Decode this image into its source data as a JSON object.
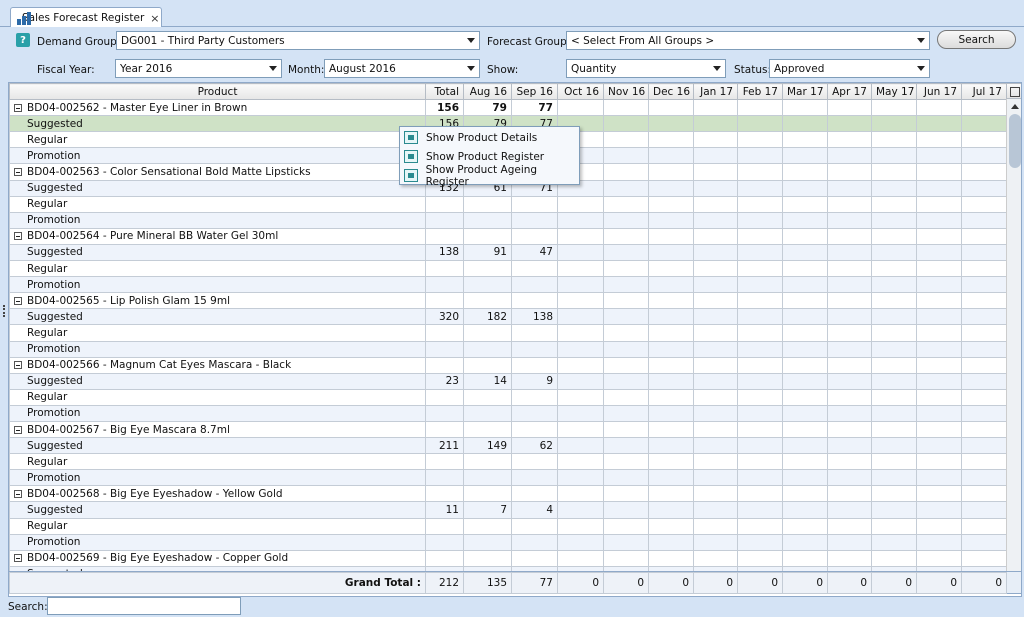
{
  "tab": {
    "title": "Sales Forecast Register",
    "close": "×"
  },
  "filters": {
    "demand_group_label": "Demand Group:",
    "demand_group_value": "DG001 - Third Party Customers",
    "forecast_group_label": "Forecast Group:",
    "forecast_group_value": "< Select From All Groups >",
    "search_button": "Search",
    "fiscal_year_label": "Fiscal Year:",
    "fiscal_year_value": "Year 2016",
    "month_label": "Month:",
    "month_value": "August 2016",
    "show_label": "Show:",
    "show_value": "Quantity",
    "status_label": "Status:",
    "status_value": "Approved"
  },
  "grid": {
    "columns": [
      "Product",
      "Total",
      "Aug 16",
      "Sep 16",
      "Oct 16",
      "Nov 16",
      "Dec 16",
      "Jan 17",
      "Feb 17",
      "Mar 17",
      "Apr 17",
      "May 17",
      "Jun 17",
      "Jul 17"
    ],
    "rows": [
      {
        "type": "parent",
        "label": "BD04-002562 - Master Eye Liner in Brown",
        "values": [
          "156",
          "79",
          "77"
        ]
      },
      {
        "type": "child",
        "label": "Suggested",
        "values": [
          "156",
          "79",
          "77"
        ],
        "highlight": true
      },
      {
        "type": "child",
        "label": "Regular",
        "values": [
          "",
          "",
          ""
        ]
      },
      {
        "type": "child",
        "label": "Promotion",
        "values": [
          "",
          "",
          ""
        ]
      },
      {
        "type": "parent",
        "label": "BD04-002563 - Color Sensational Bold Matte Lipsticks",
        "values": [
          "",
          "",
          ""
        ]
      },
      {
        "type": "child",
        "label": "Suggested",
        "values": [
          "132",
          "61",
          "71"
        ]
      },
      {
        "type": "child",
        "label": "Regular",
        "values": [
          "",
          "",
          ""
        ]
      },
      {
        "type": "child",
        "label": "Promotion",
        "values": [
          "",
          "",
          ""
        ]
      },
      {
        "type": "parent",
        "label": "BD04-002564 - Pure Mineral BB Water Gel 30ml",
        "values": [
          "",
          "",
          ""
        ]
      },
      {
        "type": "child",
        "label": "Suggested",
        "values": [
          "138",
          "91",
          "47"
        ]
      },
      {
        "type": "child",
        "label": "Regular",
        "values": [
          "",
          "",
          ""
        ]
      },
      {
        "type": "child",
        "label": "Promotion",
        "values": [
          "",
          "",
          ""
        ]
      },
      {
        "type": "parent",
        "label": "BD04-002565 - Lip Polish Glam 15 9ml",
        "values": [
          "",
          "",
          ""
        ]
      },
      {
        "type": "child",
        "label": "Suggested",
        "values": [
          "320",
          "182",
          "138"
        ]
      },
      {
        "type": "child",
        "label": "Regular",
        "values": [
          "",
          "",
          ""
        ]
      },
      {
        "type": "child",
        "label": "Promotion",
        "values": [
          "",
          "",
          ""
        ]
      },
      {
        "type": "parent",
        "label": "BD04-002566 - Magnum Cat Eyes Mascara - Black",
        "values": [
          "",
          "",
          ""
        ]
      },
      {
        "type": "child",
        "label": "Suggested",
        "values": [
          "23",
          "14",
          "9"
        ]
      },
      {
        "type": "child",
        "label": "Regular",
        "values": [
          "",
          "",
          ""
        ]
      },
      {
        "type": "child",
        "label": "Promotion",
        "values": [
          "",
          "",
          ""
        ]
      },
      {
        "type": "parent",
        "label": "BD04-002567 - Big Eye Mascara 8.7ml",
        "values": [
          "",
          "",
          ""
        ]
      },
      {
        "type": "child",
        "label": "Suggested",
        "values": [
          "211",
          "149",
          "62"
        ]
      },
      {
        "type": "child",
        "label": "Regular",
        "values": [
          "",
          "",
          ""
        ]
      },
      {
        "type": "child",
        "label": "Promotion",
        "values": [
          "",
          "",
          ""
        ]
      },
      {
        "type": "parent",
        "label": "BD04-002568 - Big Eye Eyeshadow - Yellow Gold",
        "values": [
          "",
          "",
          ""
        ]
      },
      {
        "type": "child",
        "label": "Suggested",
        "values": [
          "11",
          "7",
          "4"
        ]
      },
      {
        "type": "child",
        "label": "Regular",
        "values": [
          "",
          "",
          ""
        ]
      },
      {
        "type": "child",
        "label": "Promotion",
        "values": [
          "",
          "",
          ""
        ]
      },
      {
        "type": "parent",
        "label": "BD04-002569 - Big Eye Eyeshadow - Copper Gold",
        "values": [
          "",
          "",
          ""
        ]
      },
      {
        "type": "child",
        "label": "Suggested",
        "values": [
          "",
          "",
          ""
        ]
      }
    ]
  },
  "totals": {
    "label": "Grand Total :",
    "values": [
      "212",
      "135",
      "77",
      "0",
      "0",
      "0",
      "0",
      "0",
      "0",
      "0",
      "0",
      "0",
      "0"
    ]
  },
  "context_menu": {
    "items": [
      "Show Product Details",
      "Show Product Register",
      "Show Product Ageing Register"
    ]
  },
  "footer": {
    "search_label": "Search:",
    "search_value": ""
  }
}
